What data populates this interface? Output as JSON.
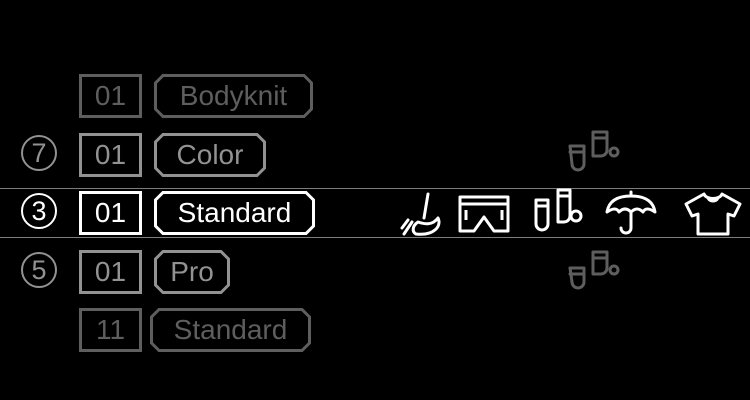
{
  "rows": [
    {
      "number": "",
      "index": "01",
      "label": "Bodyknit",
      "state": "dim"
    },
    {
      "number": "7",
      "index": "01",
      "label": "Color",
      "state": "inactive"
    },
    {
      "number": "3",
      "index": "01",
      "label": "Standard",
      "state": "selected"
    },
    {
      "number": "5",
      "index": "01",
      "label": "Pro",
      "state": "inactive"
    },
    {
      "number": "",
      "index": "11",
      "label": "Standard",
      "state": "dim"
    }
  ],
  "icons": {
    "above": [
      "socks-icon"
    ],
    "selected_row": [
      "broom-icon",
      "shorts-icon",
      "socks-icon",
      "umbrella-icon",
      "tshirt-icon"
    ],
    "below": [
      "socks-icon"
    ]
  },
  "colors": {
    "background": "#000000",
    "selected": "#ffffff",
    "inactive": "#929292",
    "dim": "#5e5e5e",
    "selection_line": "#7c7c7c"
  }
}
